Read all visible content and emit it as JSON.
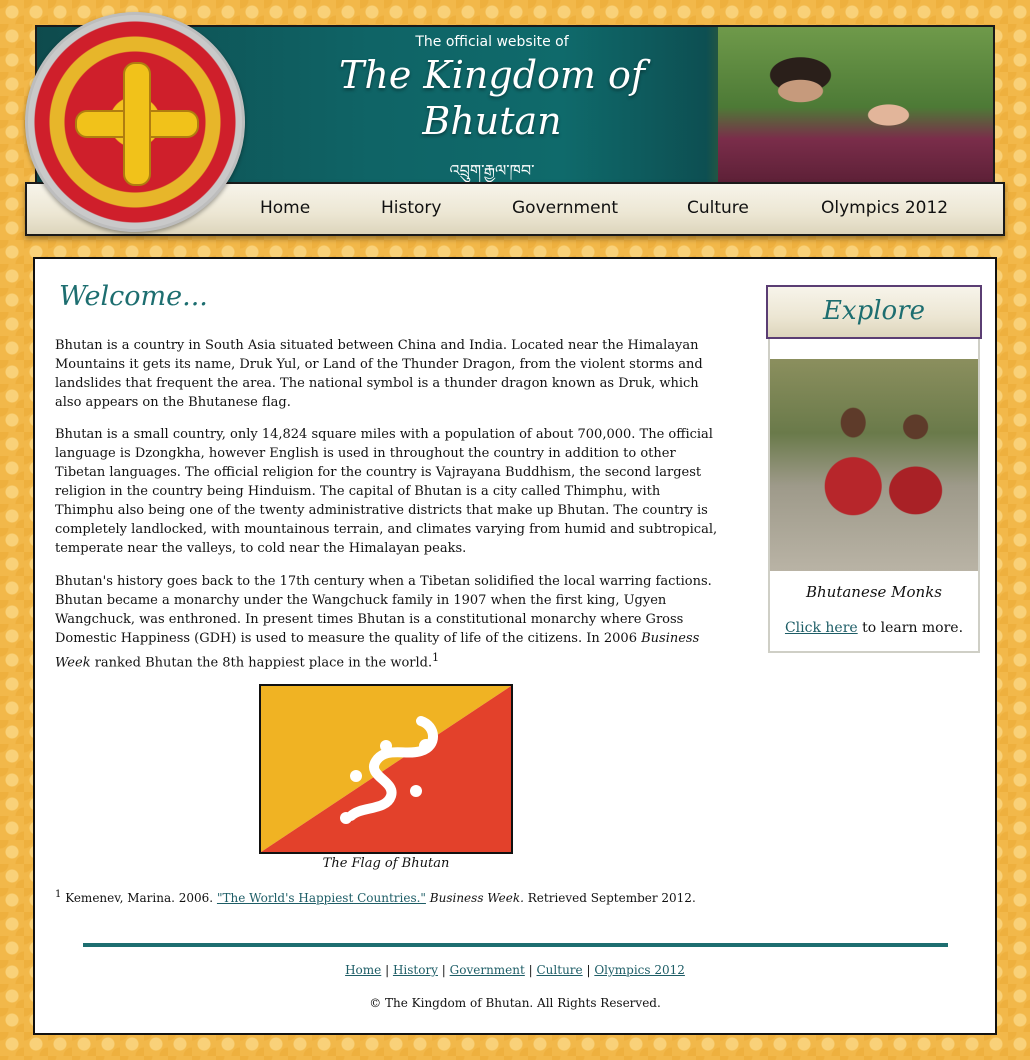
{
  "header": {
    "tagline": "The official website of",
    "title_line1": "The Kingdom of",
    "title_line2": "Bhutan",
    "dzongkha": "འབྲུག་རྒྱལ་ཁབ་"
  },
  "nav": {
    "items": [
      {
        "label": "Home"
      },
      {
        "label": "History"
      },
      {
        "label": "Government"
      },
      {
        "label": "Culture"
      },
      {
        "label": "Olympics 2012"
      }
    ]
  },
  "main": {
    "heading": "Welcome...",
    "paragraphs": [
      "Bhutan is a country in South Asia situated between China and India. Located near the Himalayan Mountains it gets its name, Druk Yul, or Land of the Thunder Dragon, from the violent storms and landslides that frequent the area. The national symbol is a thunder dragon known as Druk, which also appears on the Bhutanese flag.",
      "Bhutan is a small country, only 14,824 square miles with a population of about 700,000. The official language is Dzongkha, however English is used in throughout the country in addition to other Tibetan languages. The official religion for the country is Vajrayana Buddhism, the second largest religion in the country being Hinduism. The capital of Bhutan is a city called Thimphu, with Thimphu also being one of the twenty administrative districts that make up Bhutan. The country is completely landlocked, with mountainous terrain, and climates varying from humid and subtropical, temperate near the valleys, to cold near the Himalayan peaks."
    ],
    "p3_part1": "Bhutan's history goes back to the 17th century when a Tibetan solidified the local warring factions. Bhutan became a monarchy under the Wangchuck family in 1907 when the first king, Ugyen Wangchuck, was enthroned. In present times Bhutan is a constitutional monarchy where Gross Domestic Happiness (GDH) is used to measure the quality of life of the citizens. In 2006 ",
    "p3_italic": "Business Week",
    "p3_part2": " ranked Bhutan the 8th happiest place in the world.",
    "p3_sup": "1",
    "flag_caption": "The Flag of Bhutan",
    "footnote": {
      "sup": "1",
      "prefix": " Kemenev, Marina. 2006. ",
      "link": "\"The World's Happiest Countries.\"",
      "italic": "Business Week.",
      "suffix": " Retrieved September 2012."
    }
  },
  "sidebar": {
    "heading": "Explore",
    "caption": "Bhutanese Monks",
    "link": "Click here",
    "link_suffix": " to learn more."
  },
  "footer": {
    "links": [
      "Home",
      "History",
      "Government",
      "Culture",
      "Olympics 2012"
    ],
    "separator": " | ",
    "copyright": "© The Kingdom of Bhutan. All Rights Reserved."
  },
  "colors": {
    "teal": "#1d6e70",
    "flag_yellow": "#f0b323",
    "flag_orange": "#e3412b",
    "background": "#f2b84a"
  }
}
